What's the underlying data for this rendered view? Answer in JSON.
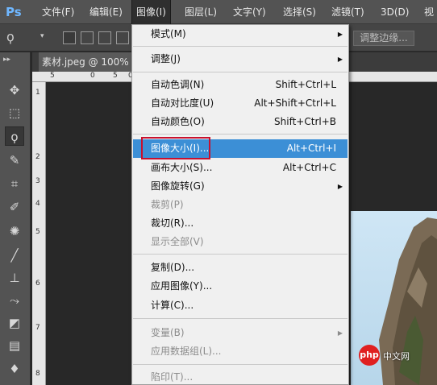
{
  "app": {
    "logo": "Ps"
  },
  "menubar": [
    {
      "label": "文件(F)"
    },
    {
      "label": "编辑(E)"
    },
    {
      "label": "图像(I)",
      "active": true
    },
    {
      "label": "图层(L)"
    },
    {
      "label": "文字(Y)"
    },
    {
      "label": "选择(S)"
    },
    {
      "label": "滤镜(T)"
    },
    {
      "label": "3D(D)"
    },
    {
      "label": "视"
    }
  ],
  "options": {
    "refine_edge": "调整边缘..."
  },
  "document_tab": "素材.jpeg @ 100%",
  "rulers": {
    "horizontal": [
      "5",
      "0",
      "5",
      "0"
    ],
    "vertical": [
      "1",
      "2",
      "3",
      "4",
      "5",
      "6",
      "7",
      "8"
    ]
  },
  "image_menu": {
    "items": [
      {
        "label": "模式(M)",
        "shortcut": "",
        "submenu": true,
        "disabled": false
      },
      {
        "sep": true
      },
      {
        "label": "调整(J)",
        "shortcut": "",
        "submenu": true,
        "disabled": false
      },
      {
        "sep": true
      },
      {
        "label": "自动色调(N)",
        "shortcut": "Shift+Ctrl+L",
        "submenu": false,
        "disabled": false
      },
      {
        "label": "自动对比度(U)",
        "shortcut": "Alt+Shift+Ctrl+L",
        "submenu": false,
        "disabled": false
      },
      {
        "label": "自动颜色(O)",
        "shortcut": "Shift+Ctrl+B",
        "submenu": false,
        "disabled": false
      },
      {
        "sep": true
      },
      {
        "label": "图像大小(I)...",
        "shortcut": "Alt+Ctrl+I",
        "submenu": false,
        "disabled": false,
        "highlighted": true
      },
      {
        "label": "画布大小(S)...",
        "shortcut": "Alt+Ctrl+C",
        "submenu": false,
        "disabled": false
      },
      {
        "label": "图像旋转(G)",
        "shortcut": "",
        "submenu": true,
        "disabled": false
      },
      {
        "label": "裁剪(P)",
        "shortcut": "",
        "submenu": false,
        "disabled": true
      },
      {
        "label": "裁切(R)...",
        "shortcut": "",
        "submenu": false,
        "disabled": false
      },
      {
        "label": "显示全部(V)",
        "shortcut": "",
        "submenu": false,
        "disabled": true
      },
      {
        "sep": true
      },
      {
        "label": "复制(D)...",
        "shortcut": "",
        "submenu": false,
        "disabled": false
      },
      {
        "label": "应用图像(Y)...",
        "shortcut": "",
        "submenu": false,
        "disabled": false
      },
      {
        "label": "计算(C)...",
        "shortcut": "",
        "submenu": false,
        "disabled": false
      },
      {
        "sep": true
      },
      {
        "label": "变量(B)",
        "shortcut": "",
        "submenu": true,
        "disabled": true
      },
      {
        "label": "应用数据组(L)...",
        "shortcut": "",
        "submenu": false,
        "disabled": true
      },
      {
        "sep": true
      },
      {
        "label": "陷印(T)...",
        "shortcut": "",
        "submenu": false,
        "disabled": true
      }
    ]
  },
  "tools": [
    {
      "name": "move-tool",
      "glyph": "✥"
    },
    {
      "name": "marquee-tool",
      "glyph": "⬚"
    },
    {
      "name": "lasso-tool",
      "glyph": "ϙ",
      "selected": true
    },
    {
      "name": "quick-selection-tool",
      "glyph": "✎"
    },
    {
      "name": "crop-tool",
      "glyph": "⌗"
    },
    {
      "name": "eyedropper-tool",
      "glyph": "✐"
    },
    {
      "name": "healing-brush-tool",
      "glyph": "✺"
    },
    {
      "name": "brush-tool",
      "glyph": "╱"
    },
    {
      "name": "clone-stamp-tool",
      "glyph": "⊥"
    },
    {
      "name": "history-brush-tool",
      "glyph": "⤳"
    },
    {
      "name": "eraser-tool",
      "glyph": "◩"
    },
    {
      "name": "gradient-tool",
      "glyph": "▤"
    },
    {
      "name": "blur-tool",
      "glyph": "♦"
    }
  ],
  "watermark": {
    "logo": "php",
    "text": "中文网"
  }
}
